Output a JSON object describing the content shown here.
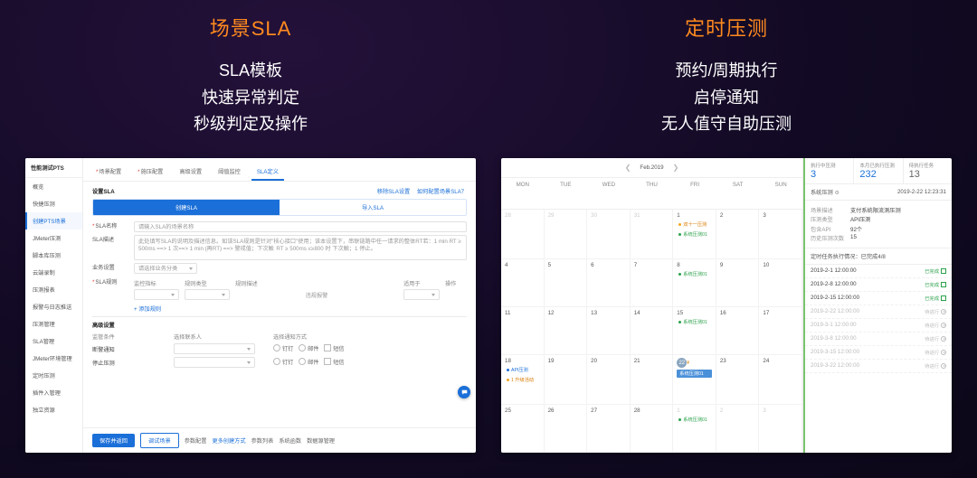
{
  "left": {
    "title": "场景SLA",
    "subs": [
      "SLA模板",
      "快速异常判定",
      "秒级判定及操作"
    ],
    "sidebar": {
      "head": "性能测试PTS",
      "items": [
        "概览",
        "快捷压测",
        "创建PTS场景",
        "JMeter压测",
        "脚本库压测",
        "云端录制",
        "压测报表",
        "报警与日志推送",
        "压测管理",
        "SLA管理",
        "JMeter环境管理",
        "定时压测",
        "插件入管理",
        "独立资源"
      ]
    },
    "tabs": [
      "场景配置",
      "施压配置",
      "高级设置",
      "阈值监控",
      "SLA定义"
    ],
    "sla": {
      "section_title": "设置SLA",
      "top_links": [
        "移除SLA设置",
        "如何配置场景SLA？"
      ],
      "seg_on": "创建SLA",
      "seg_off": "导入SLA",
      "name_label": "SLA名称",
      "name_placeholder": "请输入SLA的场景名称",
      "desc_label": "SLA描述",
      "desc_text": "此处填写SLA的说明及描述信息。如该SLA规则是针对\"核心接口\"使用；该本设置下，串联链路中任一请求的整体RT若：1 min\nRT ≥ 500ms ==> 1 次==> 1 min (再RT) ==> 警戒值；下次触  RT ≥ 500ms ≤≥800 时 下次触；1 停止。",
      "biz_label": "业务设置",
      "biz_placeholder": "请选择业务分类",
      "rules_label": "SLA规则",
      "rule_cols": [
        "监控指标",
        "规则类型",
        "规则描述",
        "适用于",
        "操作"
      ],
      "rule_placeholder": "违规报警",
      "add_rule": "+ 添加规则",
      "adv_title": "高级设置",
      "adv_cols": [
        "监管条件",
        "选择联系人",
        "选择通知方式"
      ],
      "adv_rows": [
        "断警通知",
        "停止压测"
      ],
      "notify": {
        "dd": "钉钉",
        "email": "邮件",
        "sms": "短信"
      }
    },
    "footer": {
      "save": "保存并返回",
      "debug": "调试场景",
      "links": [
        "参数配置",
        "更多创建方式",
        "参数列表",
        "系统函数",
        "数据源管理"
      ]
    }
  },
  "right": {
    "title": "定时压测",
    "subs": [
      "预约/周期执行",
      "启停通知",
      "无人值守自助压测"
    ],
    "cal": {
      "month": "Feb.2019",
      "dow": [
        "MON",
        "TUE",
        "WED",
        "THU",
        "FRI",
        "SAT",
        "SUN"
      ],
      "cells": [
        {
          "n": "28",
          "mute": true
        },
        {
          "n": "29",
          "mute": true
        },
        {
          "n": "30",
          "mute": true
        },
        {
          "n": "31",
          "mute": true
        },
        {
          "n": "1",
          "evs": [
            {
              "t": "双十一压测",
              "c": "o"
            },
            {
              "t": "系统压测01",
              "c": "g"
            }
          ]
        },
        {
          "n": "2"
        },
        {
          "n": "3"
        },
        {
          "n": "4"
        },
        {
          "n": "5"
        },
        {
          "n": "6"
        },
        {
          "n": "7"
        },
        {
          "n": "8",
          "evs": [
            {
              "t": "系统压测01",
              "c": "g"
            }
          ]
        },
        {
          "n": "9"
        },
        {
          "n": "10"
        },
        {
          "n": "11"
        },
        {
          "n": "12"
        },
        {
          "n": "13"
        },
        {
          "n": "14"
        },
        {
          "n": "15",
          "evs": [
            {
              "t": "系统压测01",
              "c": "g"
            }
          ]
        },
        {
          "n": "16"
        },
        {
          "n": "17"
        },
        {
          "n": "18",
          "evs": [
            {
              "t": "API压测",
              "c": "b"
            },
            {
              "t": "1 升级活动",
              "c": "o"
            }
          ]
        },
        {
          "n": "19"
        },
        {
          "n": "20"
        },
        {
          "n": "21"
        },
        {
          "n": "22",
          "today": true,
          "money": "¥",
          "evs": [
            {
              "t": "系统压测01",
              "c": "pill"
            }
          ]
        },
        {
          "n": "23"
        },
        {
          "n": "24"
        },
        {
          "n": "25"
        },
        {
          "n": "26"
        },
        {
          "n": "27"
        },
        {
          "n": "28"
        },
        {
          "n": "1",
          "mute": true,
          "evs": [
            {
              "t": "系统压测01",
              "c": "g"
            }
          ]
        },
        {
          "n": "2",
          "mute": true
        },
        {
          "n": "3",
          "mute": true
        }
      ]
    },
    "stats": [
      {
        "lab": "执行中压测",
        "num": "3"
      },
      {
        "lab": "本月已执行压测",
        "num": "232"
      },
      {
        "lab": "待执行任务",
        "num": "13"
      }
    ],
    "detail": {
      "head": "系统压测",
      "time": "2019-2-22  12:23:31",
      "rows": [
        {
          "l": "场景描述",
          "v": "支付系统限流测压测"
        },
        {
          "l": "压测类型",
          "v": "API压测"
        },
        {
          "l": "包含API",
          "v": "92个"
        },
        {
          "l": "历史压测次数",
          "v": "15"
        }
      ],
      "sched": "定时任务执行情况：已完成4/8",
      "runs": [
        {
          "t": "2019-2-1  12:00:00",
          "s": "已完成",
          "d": false
        },
        {
          "t": "2019-2-8  12:00:00",
          "s": "已完成",
          "d": false
        },
        {
          "t": "2019-2-15 12:00:00",
          "s": "已完成",
          "d": false
        },
        {
          "t": "2019-2-22 12:00:00",
          "s": "待进行",
          "d": true
        },
        {
          "t": "2019-3-1  12:00:00",
          "s": "待进行",
          "d": true
        },
        {
          "t": "2019-3-8  12:00:00",
          "s": "待进行",
          "d": true
        },
        {
          "t": "2019-3-15 12:00:00",
          "s": "待进行",
          "d": true
        },
        {
          "t": "2019-3-22 12:00:00",
          "s": "待进行",
          "d": true
        }
      ]
    }
  }
}
